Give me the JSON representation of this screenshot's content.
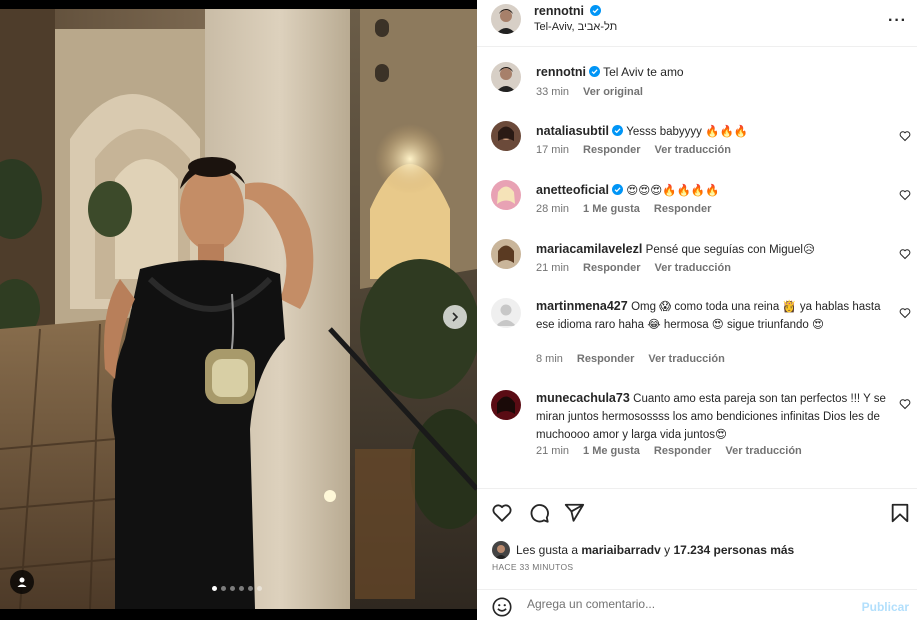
{
  "post": {
    "author": "rennotni",
    "location": "Tel-Aviv, תל-אביב",
    "caption": "Tel Aviv te amo",
    "caption_time": "33 min",
    "caption_action": "Ver original"
  },
  "comments": [
    {
      "user": "nataliasubtil",
      "verified": true,
      "text": "Yesss babyyyy 🔥🔥🔥",
      "time": "17 min",
      "actions": [
        "Responder",
        "Ver traducción"
      ]
    },
    {
      "user": "anetteoficial",
      "verified": true,
      "text": "😍😍😍🔥🔥🔥🔥",
      "time": "28 min",
      "actions": [
        "1 Me gusta",
        "Responder"
      ]
    },
    {
      "user": "mariacamilavelezl",
      "verified": false,
      "text": "Pensé que seguías con Miguel😥",
      "time": "21 min",
      "actions": [
        "Responder",
        "Ver traducción"
      ]
    },
    {
      "user": "martinmena427",
      "verified": false,
      "text": "Omg 😱 como toda una reina 👸 ya hablas hasta ese idioma raro haha 😂 hermosa 😍 sigue triunfando 😍",
      "time": "8 min",
      "actions": [
        "Responder",
        "Ver traducción"
      ]
    },
    {
      "user": "munecachula73",
      "verified": false,
      "text": "Cuanto amo esta pareja son tan perfectos !!! Y se miran juntos hermosossss los amo bendiciones infinitas Dios les de muchoooo amor y larga vida juntos😍",
      "time": "21 min",
      "actions": [
        "1 Me gusta",
        "Responder",
        "Ver traducción"
      ]
    }
  ],
  "likes": {
    "prefix": "Les gusta a",
    "first_user": "mariaibarradv",
    "joiner": "y",
    "others": "17.234 personas más"
  },
  "time_ago": "HACE 33 MINUTOS",
  "add_comment": {
    "placeholder": "Agrega un comentario...",
    "publish": "Publicar"
  },
  "carousel": {
    "count": 6,
    "active": 1
  },
  "colors": {
    "accent": "#0095f6",
    "verified": "#0095f6",
    "muted": "#737373",
    "publish_disabled": "#b2dffc"
  },
  "icons": [
    "more-icon",
    "heart-icon",
    "comment-icon",
    "share-icon",
    "bookmark-icon",
    "emoji-icon",
    "chevron-right-icon",
    "user-tag-icon",
    "verified-icon"
  ]
}
